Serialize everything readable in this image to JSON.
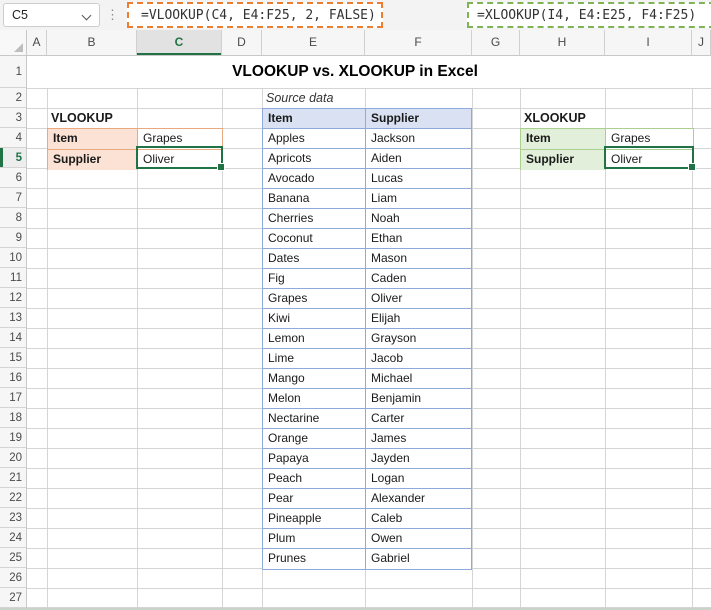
{
  "formula_bar": {
    "name_box": "C5",
    "vlookup_formula": "=VLOOKUP(C4, E4:F25, 2, FALSE)",
    "xlookup_formula": "=XLOOKUP(I4, E4:E25, F4:F25)"
  },
  "colors": {
    "active_green": "#217346",
    "orange_annotation": "#ED7D31",
    "green_annotation": "#7FB356",
    "vlookup_label_bg": "#FBE2D5",
    "vlookup_border": "#E8A97E",
    "xlookup_label_bg": "#E2EFDA",
    "xlookup_border": "#A9D08E",
    "source_header_bg": "#D9E1F2",
    "source_border": "#8EA9DB"
  },
  "sheet": {
    "title": "VLOOKUP vs. XLOOKUP in Excel",
    "column_headers": [
      "A",
      "B",
      "C",
      "D",
      "E",
      "F",
      "G",
      "H",
      "I",
      "J"
    ],
    "selected_column": "C",
    "row_count": 27,
    "selected_row": 5,
    "vlookup_block": {
      "heading": "VLOOKUP",
      "rows": [
        {
          "label": "Item",
          "value": "Grapes"
        },
        {
          "label": "Supplier",
          "value": "Oliver"
        }
      ]
    },
    "xlookup_block": {
      "heading": "XLOOKUP",
      "rows": [
        {
          "label": "Item",
          "value": "Grapes"
        },
        {
          "label": "Supplier",
          "value": "Oliver"
        }
      ]
    },
    "source_data": {
      "caption": "Source data",
      "headers": [
        "Item",
        "Supplier"
      ],
      "rows": [
        [
          "Apples",
          "Jackson"
        ],
        [
          "Apricots",
          "Aiden"
        ],
        [
          "Avocado",
          "Lucas"
        ],
        [
          "Banana",
          "Liam"
        ],
        [
          "Cherries",
          "Noah"
        ],
        [
          "Coconut",
          "Ethan"
        ],
        [
          "Dates",
          "Mason"
        ],
        [
          "Fig",
          "Caden"
        ],
        [
          "Grapes",
          "Oliver"
        ],
        [
          "Kiwi",
          "Elijah"
        ],
        [
          "Lemon",
          "Grayson"
        ],
        [
          "Lime",
          "Jacob"
        ],
        [
          "Mango",
          "Michael"
        ],
        [
          "Melon",
          "Benjamin"
        ],
        [
          "Nectarine",
          "Carter"
        ],
        [
          "Orange",
          "James"
        ],
        [
          "Papaya",
          "Jayden"
        ],
        [
          "Peach",
          "Logan"
        ],
        [
          "Pear",
          "Alexander"
        ],
        [
          "Pineapple",
          "Caleb"
        ],
        [
          "Plum",
          "Owen"
        ],
        [
          "Prunes",
          "Gabriel"
        ]
      ]
    }
  }
}
